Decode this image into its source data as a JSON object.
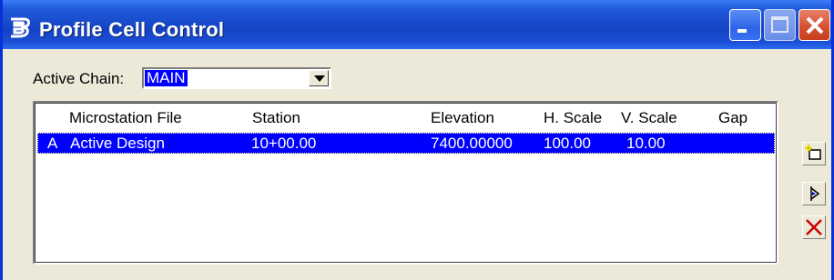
{
  "window": {
    "title": "Profile Cell Control",
    "app_icon": "bentley-b-icon",
    "title_buttons": [
      "minimize-icon",
      "maximize-icon",
      "close-icon"
    ],
    "titlebar_color": "#1542c4",
    "close_color": "#d54e2e"
  },
  "chain": {
    "label": "Active Chain:",
    "selected_value": "MAIN",
    "selection_color": "#0000ff"
  },
  "table": {
    "columns": [
      "Microstation File",
      "Station",
      "Elevation",
      "H. Scale",
      "V. Scale",
      "Gap"
    ],
    "rows": [
      {
        "marker": "A",
        "file": "Active Design",
        "station": "10+00.00",
        "elevation": "7400.00000",
        "h_scale": "100.00",
        "v_scale": "10.00",
        "gap": ""
      }
    ],
    "selected_row_index": 0
  },
  "side_toolbar": {
    "buttons": [
      "add-cell-icon",
      "modify-cell-icon",
      "delete-cell-icon"
    ]
  }
}
